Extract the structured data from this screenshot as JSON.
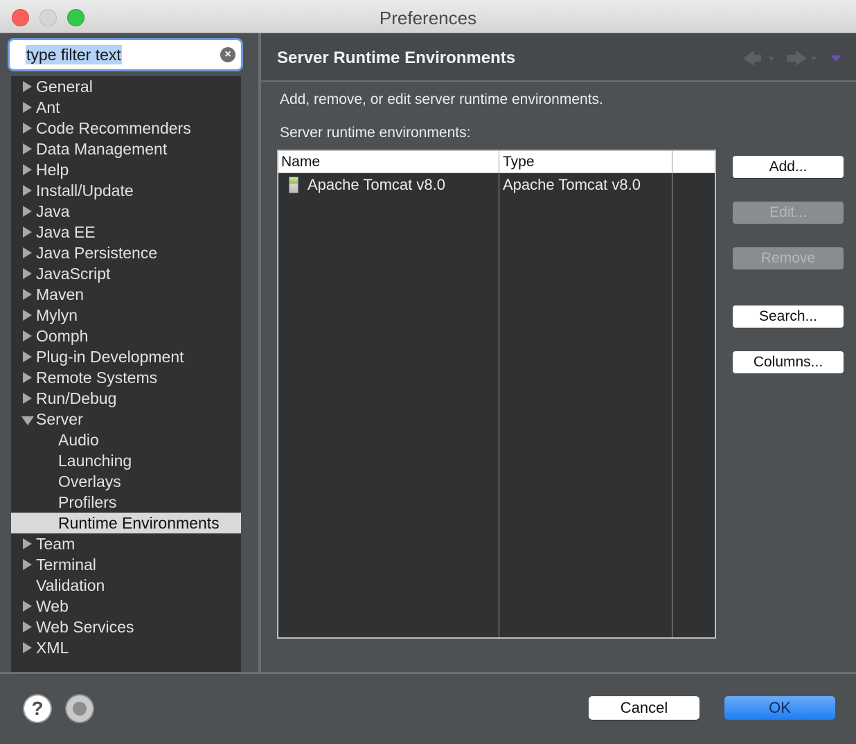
{
  "window": {
    "title": "Preferences"
  },
  "filter": {
    "value": "type filter text"
  },
  "tree": {
    "items": [
      {
        "label": "General",
        "state": "collapsed"
      },
      {
        "label": "Ant",
        "state": "collapsed"
      },
      {
        "label": "Code Recommenders",
        "state": "collapsed"
      },
      {
        "label": "Data Management",
        "state": "collapsed"
      },
      {
        "label": "Help",
        "state": "collapsed"
      },
      {
        "label": "Install/Update",
        "state": "collapsed"
      },
      {
        "label": "Java",
        "state": "collapsed"
      },
      {
        "label": "Java EE",
        "state": "collapsed"
      },
      {
        "label": "Java Persistence",
        "state": "collapsed"
      },
      {
        "label": "JavaScript",
        "state": "collapsed"
      },
      {
        "label": "Maven",
        "state": "collapsed"
      },
      {
        "label": "Mylyn",
        "state": "collapsed"
      },
      {
        "label": "Oomph",
        "state": "collapsed"
      },
      {
        "label": "Plug-in Development",
        "state": "collapsed"
      },
      {
        "label": "Remote Systems",
        "state": "collapsed"
      },
      {
        "label": "Run/Debug",
        "state": "collapsed"
      },
      {
        "label": "Server",
        "state": "expanded"
      },
      {
        "label": "Audio",
        "state": "child"
      },
      {
        "label": "Launching",
        "state": "child"
      },
      {
        "label": "Overlays",
        "state": "child"
      },
      {
        "label": "Profilers",
        "state": "child"
      },
      {
        "label": "Runtime Environments",
        "state": "child-selected"
      },
      {
        "label": "Team",
        "state": "collapsed"
      },
      {
        "label": "Terminal",
        "state": "collapsed"
      },
      {
        "label": "Validation",
        "state": "leaf"
      },
      {
        "label": "Web",
        "state": "collapsed"
      },
      {
        "label": "Web Services",
        "state": "collapsed"
      },
      {
        "label": "XML",
        "state": "collapsed"
      }
    ]
  },
  "page": {
    "title": "Server Runtime Environments",
    "description": "Add, remove, or edit server runtime environments.",
    "table_caption": "Server runtime environments:"
  },
  "table": {
    "columns": [
      "Name",
      "Type"
    ],
    "rows": [
      {
        "name": "Apache Tomcat v8.0",
        "type": "Apache Tomcat v8.0"
      }
    ]
  },
  "side_buttons": {
    "add": "Add...",
    "edit": "Edit...",
    "remove": "Remove",
    "search": "Search...",
    "columns": "Columns..."
  },
  "footer": {
    "help_glyph": "?",
    "cancel": "Cancel",
    "ok": "OK"
  },
  "icons": {
    "help": "help-icon",
    "preferences": "preferences-icon",
    "back": "back-arrow-icon",
    "forward": "forward-arrow-icon",
    "view_menu": "view-menu-icon",
    "clear": "clear-icon",
    "server": "server-icon"
  },
  "colors": {
    "accent": "#1f7ef1",
    "selection": "#d9d9d9",
    "tree_background": "#2f3133"
  }
}
